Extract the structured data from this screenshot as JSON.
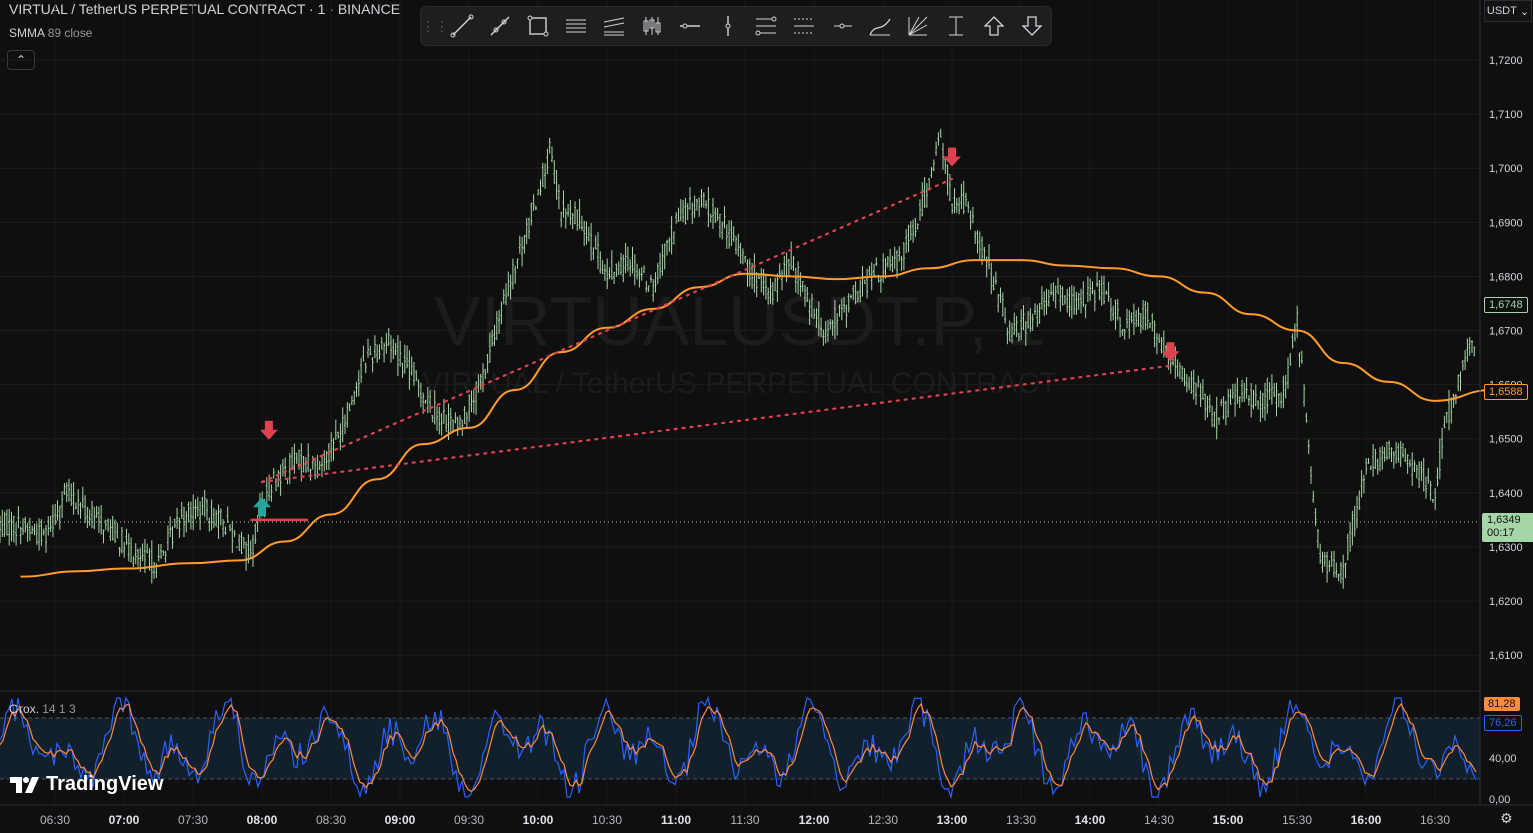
{
  "header": {
    "symbol_title": "VIRTUAL / TetherUS PERPETUAL CONTRACT · 1 · BINANCE",
    "indicator_name": "SMMA",
    "indicator_params": "89 close",
    "collapse_glyph": "⌃"
  },
  "watermark": {
    "ticker": "VIRTUALUSDT.P, 1",
    "name": "VIRTUAL / TetherUS PERPETUAL CONTRACT"
  },
  "currency_selector": {
    "label": "USDT",
    "chevron": "⌄"
  },
  "toolbar": {
    "tools": [
      "trend-line",
      "ray",
      "rectangle",
      "parallel-channel",
      "regression-trend",
      "long-short",
      "horizontal-line",
      "vertical-line",
      "fib-retracement",
      "fib-extension",
      "horizontal-ray",
      "pitchfork",
      "fib-fan",
      "price-range",
      "arrow-up",
      "arrow-down"
    ]
  },
  "price_axis": {
    "ticks": [
      "1,7200",
      "1,7100",
      "1,7000",
      "1,6900",
      "1,6800",
      "1,6700",
      "1,6600",
      "1,6500",
      "1,6400",
      "1,6300",
      "1,6200",
      "1,6100"
    ],
    "tags": {
      "upper_green": "1,6748",
      "smma_orange": "1,6588",
      "last_price": "1,6349",
      "countdown": "00:17"
    }
  },
  "time_axis": {
    "ticks": [
      "06:30",
      "07:00",
      "07:30",
      "08:00",
      "08:30",
      "09:00",
      "09:30",
      "10:00",
      "10:30",
      "11:00",
      "11:30",
      "12:00",
      "12:30",
      "13:00",
      "13:30",
      "14:00",
      "14:30",
      "15:00",
      "15:30",
      "16:00",
      "16:30"
    ]
  },
  "stochastic": {
    "name": "Стох.",
    "params": "14 1 3",
    "axis_ticks": [
      "40,00",
      "0,00"
    ],
    "k_value": "81,28",
    "d_value": "76,26"
  },
  "branding": {
    "logo_text": "TradingView"
  },
  "colors": {
    "candle": "#a5d6a7",
    "smma": "#ff9c2a",
    "dotted_line": "#e0414e",
    "arrow_down": "#e0414e",
    "arrow_up": "#26a69a",
    "stoch_k": "#2962ff",
    "stoch_d": "#ff8a3d",
    "last_price_bg": "#a5d6a7",
    "smma_tag_bg": "#ff9c2a"
  },
  "chart_data": {
    "type": "candlestick",
    "symbol": "VIRTUALUSDT.P",
    "interval": "1",
    "ylim": [
      1.6065,
      1.7235
    ],
    "x_ticks": [
      "06:30",
      "07:00",
      "07:30",
      "08:00",
      "08:30",
      "09:00",
      "09:30",
      "10:00",
      "10:30",
      "11:00",
      "11:30",
      "12:00",
      "12:30",
      "13:00",
      "13:30",
      "14:00",
      "14:30",
      "15:00",
      "15:30",
      "16:00",
      "16:30"
    ],
    "price_path": [
      [
        "06:15",
        1.634
      ],
      [
        "06:25",
        1.632
      ],
      [
        "06:35",
        1.64
      ],
      [
        "06:45",
        1.636
      ],
      [
        "06:55",
        1.633
      ],
      [
        "07:05",
        1.628
      ],
      [
        "07:15",
        1.627
      ],
      [
        "07:25",
        1.636
      ],
      [
        "07:35",
        1.637
      ],
      [
        "07:45",
        1.634
      ],
      [
        "07:55",
        1.628
      ],
      [
        "08:00",
        1.638
      ],
      [
        "08:05",
        1.642
      ],
      [
        "08:15",
        1.646
      ],
      [
        "08:25",
        1.645
      ],
      [
        "08:35",
        1.652
      ],
      [
        "08:45",
        1.665
      ],
      [
        "08:55",
        1.668
      ],
      [
        "09:05",
        1.662
      ],
      [
        "09:15",
        1.655
      ],
      [
        "09:25",
        1.652
      ],
      [
        "09:35",
        1.66
      ],
      [
        "09:45",
        1.675
      ],
      [
        "09:55",
        1.688
      ],
      [
        "10:05",
        1.703
      ],
      [
        "10:10",
        1.692
      ],
      [
        "10:20",
        1.69
      ],
      [
        "10:30",
        1.68
      ],
      [
        "10:40",
        1.683
      ],
      [
        "10:50",
        1.678
      ],
      [
        "11:00",
        1.69
      ],
      [
        "11:10",
        1.694
      ],
      [
        "11:20",
        1.69
      ],
      [
        "11:30",
        1.683
      ],
      [
        "11:40",
        1.676
      ],
      [
        "11:50",
        1.683
      ],
      [
        "12:00",
        1.673
      ],
      [
        "12:05",
        1.67
      ],
      [
        "12:15",
        1.675
      ],
      [
        "12:25",
        1.68
      ],
      [
        "12:35",
        1.682
      ],
      [
        "12:45",
        1.69
      ],
      [
        "12:55",
        1.706
      ],
      [
        "13:00",
        1.693
      ],
      [
        "13:05",
        1.694
      ],
      [
        "13:15",
        1.683
      ],
      [
        "13:25",
        1.67
      ],
      [
        "13:35",
        1.672
      ],
      [
        "13:45",
        1.677
      ],
      [
        "13:55",
        1.675
      ],
      [
        "14:05",
        1.678
      ],
      [
        "14:15",
        1.671
      ],
      [
        "14:25",
        1.673
      ],
      [
        "14:35",
        1.664
      ],
      [
        "14:45",
        1.66
      ],
      [
        "14:55",
        1.654
      ],
      [
        "15:05",
        1.658
      ],
      [
        "15:15",
        1.657
      ],
      [
        "15:25",
        1.659
      ],
      [
        "15:30",
        1.672
      ],
      [
        "15:35",
        1.65
      ],
      [
        "15:40",
        1.627
      ],
      [
        "15:50",
        1.626
      ],
      [
        "16:00",
        1.644
      ],
      [
        "16:10",
        1.648
      ],
      [
        "16:20",
        1.645
      ],
      [
        "16:30",
        1.64
      ],
      [
        "16:35",
        1.654
      ],
      [
        "16:45",
        1.666
      ],
      [
        "16:55",
        1.672
      ]
    ],
    "smma_89": [
      [
        "06:15",
        1.6245
      ],
      [
        "06:40",
        1.6255
      ],
      [
        "07:00",
        1.626
      ],
      [
        "07:30",
        1.627
      ],
      [
        "07:50",
        1.6275
      ],
      [
        "08:10",
        1.631
      ],
      [
        "08:30",
        1.636
      ],
      [
        "08:50",
        1.6425
      ],
      [
        "09:10",
        1.649
      ],
      [
        "09:30",
        1.652
      ],
      [
        "09:50",
        1.659
      ],
      [
        "10:10",
        1.666
      ],
      [
        "10:30",
        1.6705
      ],
      [
        "10:50",
        1.674
      ],
      [
        "11:10",
        1.678
      ],
      [
        "11:30",
        1.6805
      ],
      [
        "11:50",
        1.68
      ],
      [
        "12:10",
        1.6795
      ],
      [
        "12:30",
        1.68
      ],
      [
        "12:50",
        1.6815
      ],
      [
        "13:10",
        1.683
      ],
      [
        "13:30",
        1.683
      ],
      [
        "13:50",
        1.682
      ],
      [
        "14:10",
        1.6815
      ],
      [
        "14:30",
        1.68
      ],
      [
        "14:50",
        1.677
      ],
      [
        "15:10",
        1.673
      ],
      [
        "15:30",
        1.67
      ],
      [
        "15:50",
        1.664
      ],
      [
        "16:10",
        1.6605
      ],
      [
        "16:30",
        1.657
      ],
      [
        "16:55",
        1.659
      ]
    ],
    "annotations": [
      {
        "type": "dotted-line",
        "from": [
          "08:00",
          1.642
        ],
        "to": [
          "13:00",
          1.698
        ]
      },
      {
        "type": "dotted-line",
        "from": [
          "08:00",
          1.642
        ],
        "to": [
          "14:35",
          1.6635
        ]
      },
      {
        "type": "arrow-down",
        "at": [
          "08:03",
          1.65
        ]
      },
      {
        "type": "arrow-up",
        "at": [
          "08:00",
          1.639
        ]
      },
      {
        "type": "arrow-down",
        "at": [
          "13:00",
          1.7005
        ]
      },
      {
        "type": "arrow-down",
        "at": [
          "14:35",
          1.6645
        ]
      },
      {
        "type": "horizontal-segment",
        "from": [
          "07:55",
          1.635
        ],
        "to": [
          "08:20",
          1.635
        ]
      }
    ],
    "last_price": 1.6349
  }
}
